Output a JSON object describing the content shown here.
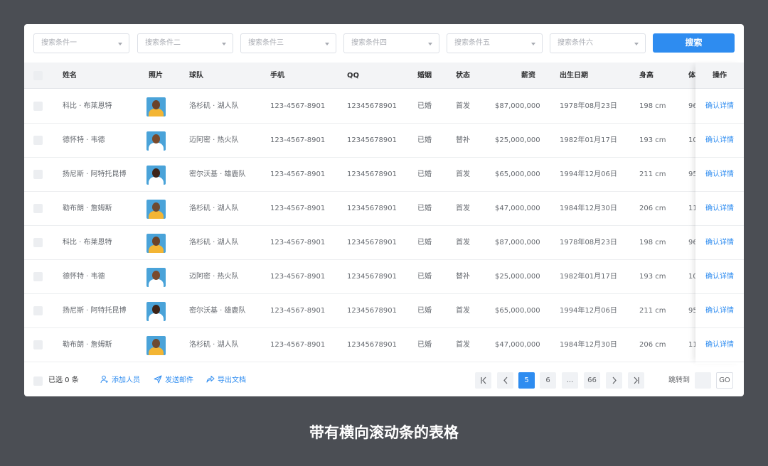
{
  "search": {
    "fields": [
      "搜索条件一",
      "搜索条件二",
      "搜索条件三",
      "搜索条件四",
      "搜索条件五",
      "搜索条件六"
    ],
    "button": "搜索"
  },
  "table": {
    "headers": {
      "name": "姓名",
      "photo": "照片",
      "team": "球队",
      "phone": "手机",
      "qq": "QQ",
      "marital": "婚姻",
      "status": "状态",
      "salary": "薪资",
      "birth": "出生日期",
      "height": "身高",
      "weight": "体",
      "action": "操作"
    },
    "rows": [
      {
        "name": "科比 · 布莱恩特",
        "team": "洛杉矶 · 湖人队",
        "phone": "123-4567-8901",
        "qq": "12345678901",
        "marital": "已婚",
        "status": "首发",
        "salary": "$87,000,000",
        "birth": "1978年08月23日",
        "height": "198 cm",
        "weight": "96",
        "action": "确认详情",
        "jersey": "#f3b534"
      },
      {
        "name": "德怀特 · 韦德",
        "team": "迈阿密 · 热火队",
        "phone": "123-4567-8901",
        "qq": "12345678901",
        "marital": "已婚",
        "status": "替补",
        "salary": "$25,000,000",
        "birth": "1982年01月17日",
        "height": "193 cm",
        "weight": "10",
        "action": "确认详情",
        "jersey": "#ffffff"
      },
      {
        "name": "扬尼斯 · 阿特托昆博",
        "team": "密尔沃基 · 雄鹿队",
        "phone": "123-4567-8901",
        "qq": "12345678901",
        "marital": "已婚",
        "status": "首发",
        "salary": "$65,000,000",
        "birth": "1994年12月06日",
        "height": "211 cm",
        "weight": "95",
        "action": "确认详情",
        "jersey": "#ffffff"
      },
      {
        "name": "勒布朗 · 詹姆斯",
        "team": "洛杉矶 · 湖人队",
        "phone": "123-4567-8901",
        "qq": "12345678901",
        "marital": "已婚",
        "status": "首发",
        "salary": "$47,000,000",
        "birth": "1984年12月30日",
        "height": "206 cm",
        "weight": "11",
        "action": "确认详情",
        "jersey": "#f3b534"
      },
      {
        "name": "科比 · 布莱恩特",
        "team": "洛杉矶 · 湖人队",
        "phone": "123-4567-8901",
        "qq": "12345678901",
        "marital": "已婚",
        "status": "首发",
        "salary": "$87,000,000",
        "birth": "1978年08月23日",
        "height": "198 cm",
        "weight": "96",
        "action": "确认详情",
        "jersey": "#f3b534"
      },
      {
        "name": "德怀特 · 韦德",
        "team": "迈阿密 · 热火队",
        "phone": "123-4567-8901",
        "qq": "12345678901",
        "marital": "已婚",
        "status": "替补",
        "salary": "$25,000,000",
        "birth": "1982年01月17日",
        "height": "193 cm",
        "weight": "10",
        "action": "确认详情",
        "jersey": "#ffffff"
      },
      {
        "name": "扬尼斯 · 阿特托昆博",
        "team": "密尔沃基 · 雄鹿队",
        "phone": "123-4567-8901",
        "qq": "12345678901",
        "marital": "已婚",
        "status": "首发",
        "salary": "$65,000,000",
        "birth": "1994年12月06日",
        "height": "211 cm",
        "weight": "95",
        "action": "确认详情",
        "jersey": "#ffffff"
      },
      {
        "name": "勒布朗 · 詹姆斯",
        "team": "洛杉矶 · 湖人队",
        "phone": "123-4567-8901",
        "qq": "12345678901",
        "marital": "已婚",
        "status": "首发",
        "salary": "$47,000,000",
        "birth": "1984年12月30日",
        "height": "206 cm",
        "weight": "11",
        "action": "确认详情",
        "jersey": "#f3b534"
      }
    ]
  },
  "footer": {
    "selected": "已选 0 条",
    "add_member": "添加人员",
    "send_mail": "发送邮件",
    "export_doc": "导出文档",
    "pages": [
      "5",
      "6",
      "...",
      "66"
    ],
    "active_page": "5",
    "jump_label": "跳转到",
    "go": "GO"
  },
  "caption": "带有横向滚动条的表格",
  "colors": {
    "accent": "#2e8cf0",
    "background": "#4b4e54"
  }
}
